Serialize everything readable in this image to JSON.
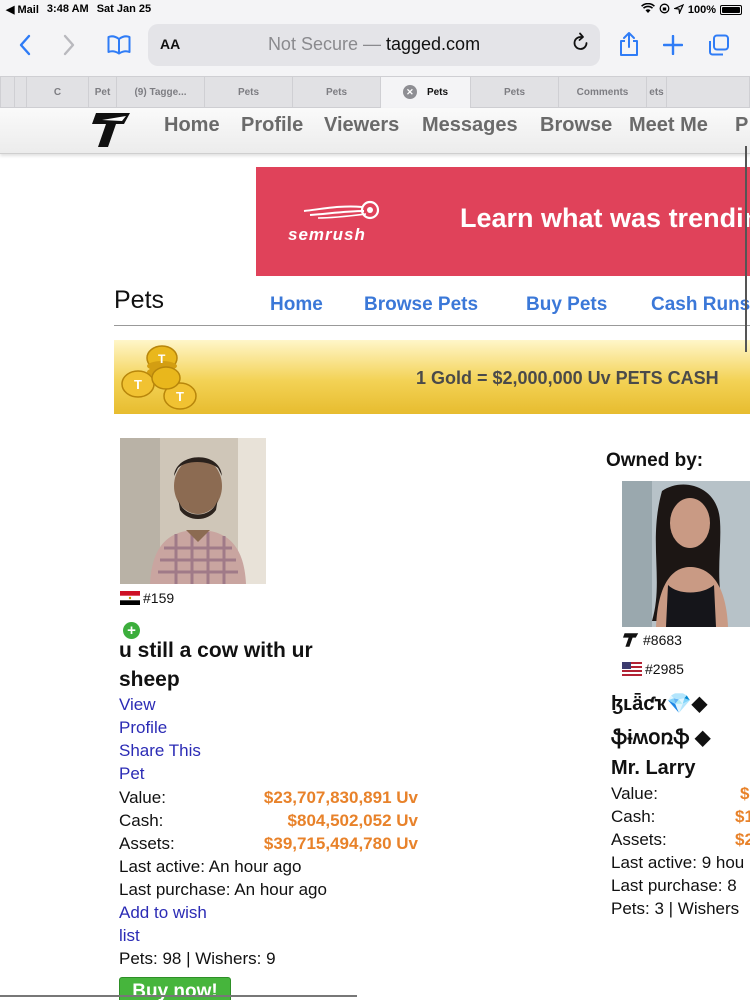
{
  "status_bar": {
    "back_app": "◀ Mail",
    "time": "3:48 AM",
    "date": "Sat Jan 25",
    "battery": "100%"
  },
  "toolbar": {
    "text_size_label": "AA",
    "security_label": "Not Secure",
    "separator": " — ",
    "domain": "tagged.com"
  },
  "tabs": [
    {
      "label": "C"
    },
    {
      "label": "Pet"
    },
    {
      "label": "(9) Tagge..."
    },
    {
      "label": "Pets"
    },
    {
      "label": "Pets"
    },
    {
      "label": "Pets"
    },
    {
      "label": "Pets"
    },
    {
      "label": "Comments"
    },
    {
      "label": "ets"
    }
  ],
  "site_nav": {
    "items": [
      "Home",
      "Profile",
      "Viewers",
      "Messages",
      "Browse",
      "Meet Me",
      "P"
    ]
  },
  "ad": {
    "brand": "semrush",
    "message": "Learn what was trending"
  },
  "pets_header": {
    "title": "Pets",
    "menu": [
      "Home",
      "Browse Pets",
      "Buy Pets",
      "Cash Runs"
    ]
  },
  "gold_banner": {
    "text": "1 Gold = $2,000,000 Uv PETS CASH"
  },
  "pet": {
    "rank": "#159",
    "name": "u still a cow with ur sheep",
    "links": {
      "view_profile_1": "View",
      "view_profile_2": "Profile",
      "share_1": "Share This",
      "share_2": "Pet",
      "wish_1": "Add to wish",
      "wish_2": "list"
    },
    "value_label": "Value:",
    "value": "$23,707,830,891 Uv",
    "cash_label": "Cash:",
    "cash": "$804,502,052 Uv",
    "assets_label": "Assets:",
    "assets": "$39,715,494,780 Uv",
    "last_active": "Last active: An hour ago",
    "last_purchase": "Last purchase: An hour ago",
    "pets_wishers": "Pets: 98  |  Wishers: 9",
    "buy_label": "Buy now!"
  },
  "owner": {
    "heading": "Owned by:",
    "rank_tagged": "#8683",
    "rank_flag": "#2985",
    "name_line1": "ɮʟǟƈҡ💎◆",
    "name_line2": "ֆɨʍօռֆ ◆",
    "name_line3": "Mr. Larry",
    "value_label": "Value:",
    "value_partial": "$",
    "cash_label": "Cash:",
    "cash_partial": "$1",
    "assets_label": "Assets:",
    "assets_partial": "$2",
    "last_active": "Last active: 9 hou",
    "last_purchase": "Last purchase: 8",
    "pets_wishers": "Pets: 3  |  Wishers"
  },
  "colors": {
    "link_blue": "#3b78d8",
    "link_dark": "#2b2bb5",
    "money_orange": "#e8822a",
    "ad_red": "#e0425a",
    "buy_green": "#46b53c"
  }
}
